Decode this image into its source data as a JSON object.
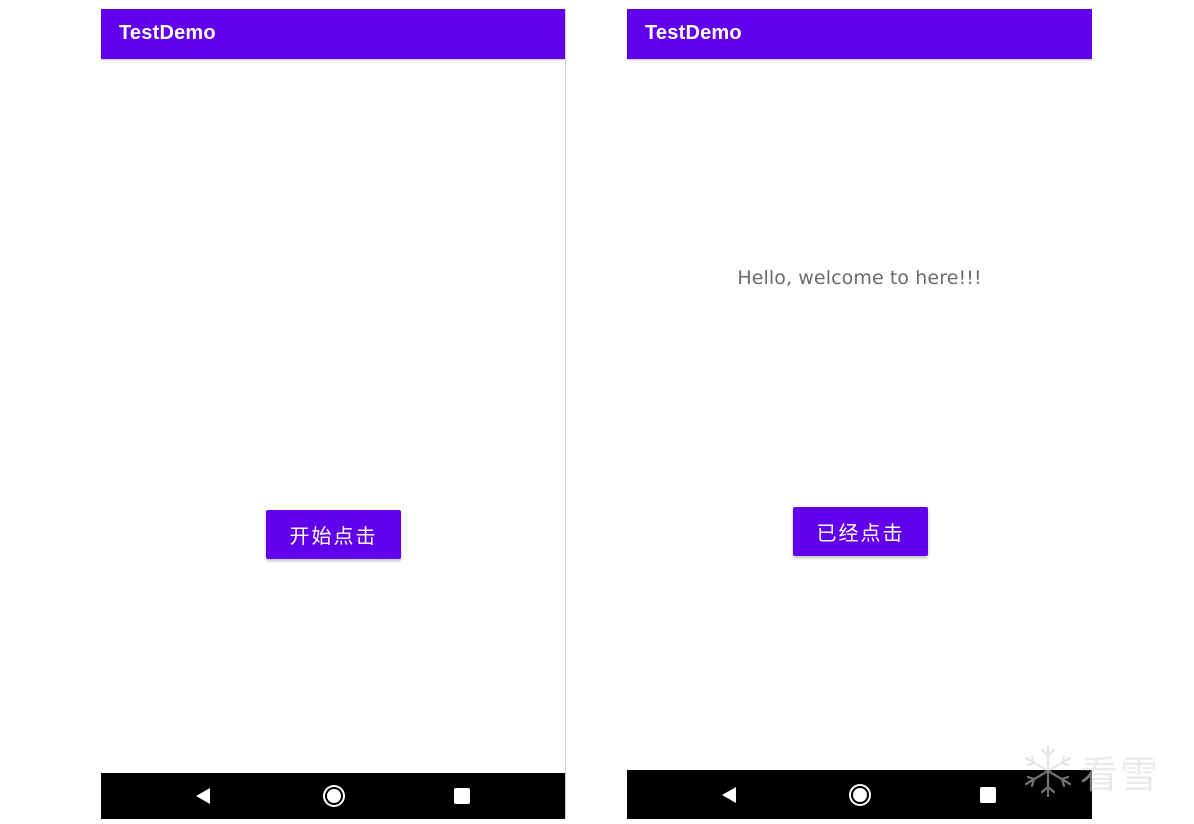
{
  "colors": {
    "primary": "#6200EE",
    "nav_bar": "#000000",
    "text_secondary": "#6b6b6b"
  },
  "screens": [
    {
      "app_title": "TestDemo",
      "button_label": "开始点击",
      "message": ""
    },
    {
      "app_title": "TestDemo",
      "button_label": "已经点击",
      "message": "Hello, welcome to here!!!"
    }
  ],
  "nav_icons": [
    "back-icon",
    "home-icon",
    "recents-icon"
  ],
  "watermark": {
    "icon": "snowflake-icon",
    "text": "看雪"
  }
}
